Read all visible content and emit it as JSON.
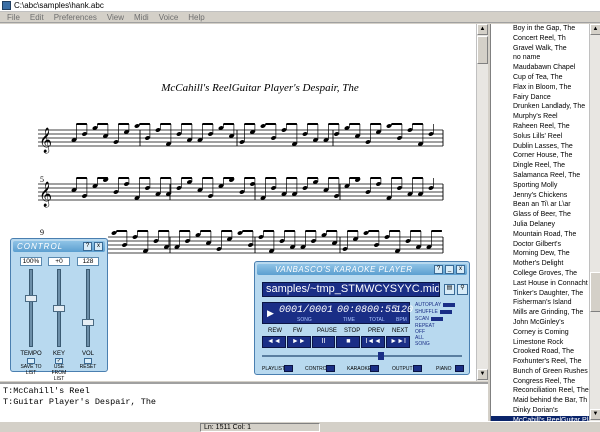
{
  "window": {
    "title": "C:\\abc\\samples\\hank.abc"
  },
  "menu": [
    "File",
    "Edit",
    "Preferences",
    "View",
    "Midi",
    "Voice",
    "Help"
  ],
  "score": {
    "tune_title": "McCahill's ReelGuitar Player's Despair, The",
    "measure_numbers": [
      "5",
      "9"
    ]
  },
  "tune_list": [
    "Boy in the Gap, The",
    "Concert Reel, Th",
    "Gravel Walk, The",
    "no name",
    "Maudabawn Chapel",
    "Cup of Tea, The",
    "Flax in Bloom, The",
    "Fairy Dance",
    "Drunken Landlady, The",
    "Murphy's Reel",
    "Raheen Reel, The",
    "Solus Lills' Reel",
    "Dublin Lasses, The",
    "Corner House, The",
    "Dingle Reel, The",
    "Salamanca Reel, The",
    "Sporting Molly",
    "Jenny's Chickens",
    "Bean an Ti\\ ar L\\ar",
    "Glass of Beer, The",
    "Julia Delaney",
    "Mountain Road, The",
    "Doctor Gilbert's",
    "Morning Dew, The",
    "Mother's Delight",
    "College Groves, The",
    "Last House in Connacht",
    "Tinker's Daughter, The",
    "Fisherman's Island",
    "Mills are Grinding, The",
    "John McGinley's",
    "Corney is Coming",
    "Limestone Rock",
    "Crooked Road, The",
    "Foxhunter's Reel, The",
    "Bunch of Green Rushes",
    "Congress Reel, The",
    "Reconciliation Reel, The",
    "Maid behind the Bar, Th",
    "Dinky Dorian's",
    "McCahill's ReelGuitar Pla"
  ],
  "tune_list_selected_index": 40,
  "editor": {
    "lines": [
      "T:McCahill's Reel",
      "T:Guitar Player's Despair, The"
    ]
  },
  "status": {
    "position": "Ln: 1511 Col: 1"
  },
  "control": {
    "title": "CONTROL",
    "help_label": "?",
    "close_label": "x",
    "readouts": [
      "100%",
      "+0",
      "128"
    ],
    "slider_labels": [
      "TEMPO",
      "KEY",
      "VOL"
    ],
    "save_label": "SAVE TO LIST",
    "use_label": "USE FROM LIST",
    "reset_label": "RESET",
    "slider_levels": [
      0.65,
      0.5,
      0.3
    ]
  },
  "karaoke": {
    "title": "VANBASCO'S KARAOKE PLAYER",
    "help_label": "?",
    "min_label": "_",
    "close_label": "x",
    "file": "samples/~tmp_STMWCYSYYC.mid",
    "song_time": "0001/0001",
    "time": "00:08",
    "total": "00:55",
    "bpm": "120",
    "unit_labels": [
      "SONG",
      "TIME",
      "TOTAL",
      "BPM"
    ],
    "side_labels": [
      "AUTOPLAY",
      "SHUFFLE",
      "SCAN",
      "REPEAT",
      "OFF",
      "ALL",
      "SONG"
    ],
    "transport_labels": [
      "REW",
      "FW",
      "PAUSE",
      "STOP",
      "PREV",
      "NEXT"
    ],
    "transport_symbols": [
      "◄◄",
      "►►",
      "II",
      "■",
      "I◄◄",
      "►►I"
    ],
    "bottom_labels": [
      "PLAYLIST",
      "CONTROL",
      "KARAOKE",
      "OUTPUT",
      "PIANO"
    ],
    "progress": 0.6
  }
}
